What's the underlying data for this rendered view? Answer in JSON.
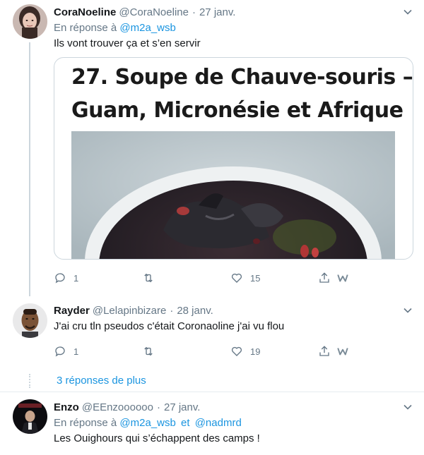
{
  "tweets": [
    {
      "name": "CoraNoeline",
      "handle": "@CoraNoeline",
      "dot": "·",
      "time": "27 janv.",
      "reply_prefix": "En réponse à",
      "reply_users": [
        "@m2a_wsb"
      ],
      "text": "Ils vont trouver ça et s’en servir",
      "media": {
        "line1": "27.  Soupe de Chauve-souris –",
        "line2": "Guam, Micronésie et Afrique"
      },
      "actions": {
        "replies": "1",
        "retweets": "",
        "likes": "15"
      }
    },
    {
      "name": "Rayder",
      "handle": "@Lelapinbizare",
      "dot": "·",
      "time": "28 janv.",
      "text": "J'ai cru tln pseudos c'était Coronaoline j'ai vu flou",
      "actions": {
        "replies": "1",
        "retweets": "",
        "likes": "19"
      }
    },
    {
      "name": "Enzo",
      "handle": "@EEnzoooooo",
      "dot": "·",
      "time": "27 janv.",
      "reply_prefix": "En réponse à",
      "reply_users": [
        "@m2a_wsb",
        "@nadmrd"
      ],
      "reply_joiner": "et",
      "text": "Les Ouighours qui s’échappent des camps !"
    }
  ],
  "more_replies": "3 réponses de plus",
  "colors": {
    "link": "#1b95e0",
    "muted": "#657786",
    "border": "#ccd6dd"
  },
  "icons": [
    "chevron-down-icon",
    "reply-icon",
    "retweet-icon",
    "like-icon",
    "share-icon",
    "w-icon"
  ]
}
